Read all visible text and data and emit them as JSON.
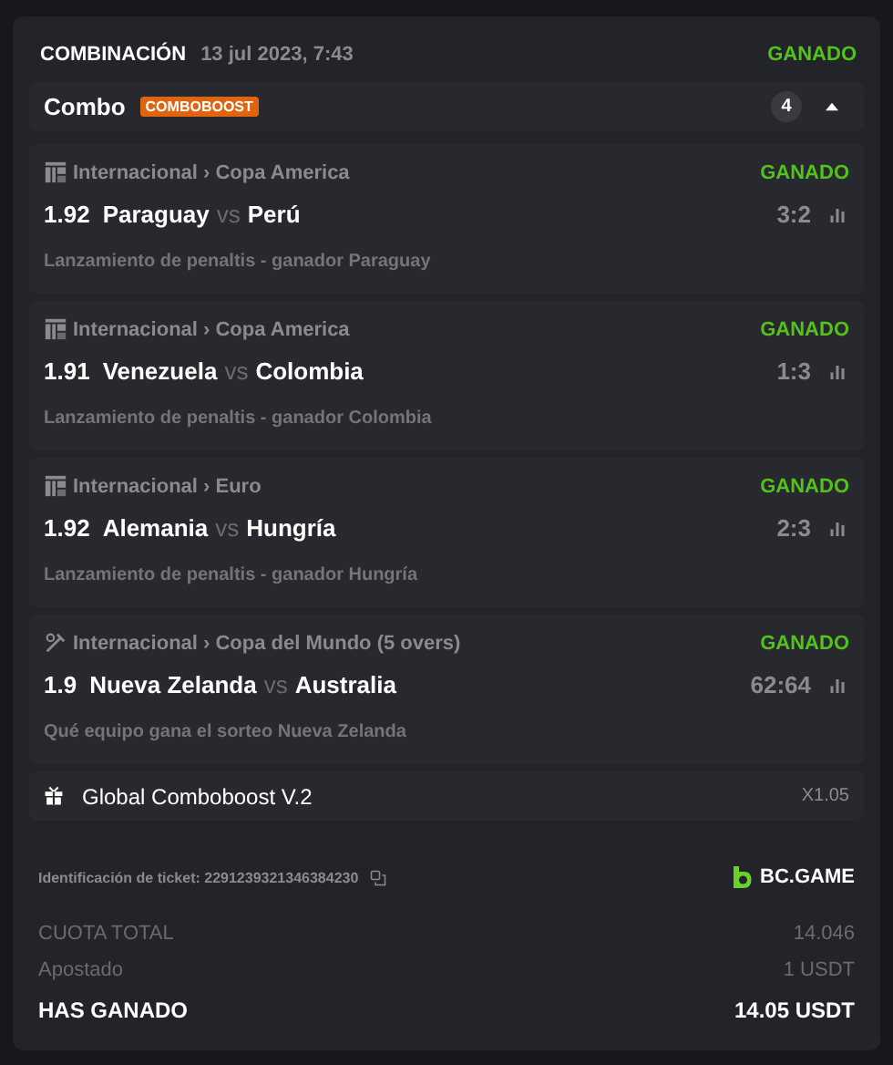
{
  "bet": {
    "type": "COMBINACIÓN",
    "date": "13 jul 2023, 7:43",
    "status": "GANADO",
    "won": true
  },
  "combo": {
    "title": "Combo",
    "badge": "COMBOBOOST",
    "count": "4",
    "expanded": true
  },
  "legs": [
    {
      "kind": "fifa",
      "path": "Internacional › Copa America",
      "status": "GANADO",
      "won": true,
      "odds": "1.92",
      "home": "Paraguay",
      "vs": "vs",
      "away": "Perú",
      "score": "3:2",
      "market": "Lanzamiento de penaltis - ganador Paraguay"
    },
    {
      "kind": "fifa",
      "path": "Internacional › Copa America",
      "status": "GANADO",
      "won": true,
      "odds": "1.91",
      "home": "Venezuela",
      "vs": "vs",
      "away": "Colombia",
      "score": "1:3",
      "market": "Lanzamiento de penaltis - ganador Colombia"
    },
    {
      "kind": "fifa",
      "path": "Internacional › Euro",
      "status": "GANADO",
      "won": true,
      "odds": "1.92",
      "home": "Alemania",
      "vs": "vs",
      "away": "Hungría",
      "score": "2:3",
      "market": "Lanzamiento de penaltis - ganador Hungría"
    },
    {
      "kind": "cricket",
      "path": "Internacional › Copa del Mundo (5 overs)",
      "status": "GANADO",
      "won": true,
      "odds": "1.9",
      "home": "Nueva Zelanda",
      "vs": "vs",
      "away": "Australia",
      "score": "62:64",
      "market": "Qué equipo gana el sorteo Nueva Zelanda"
    }
  ],
  "boost": {
    "label": "Global Comboboost V.2",
    "multiplier": "X1.05"
  },
  "ticket": {
    "label": "Identificación de ticket: 2291239321346384230",
    "brand": "BC.GAME"
  },
  "totals": [
    {
      "label": "CUOTA TOTAL",
      "value": "14.046",
      "emphasis": false
    },
    {
      "label": "Apostado",
      "value": "1 USDT",
      "emphasis": false
    },
    {
      "label": "HAS GANADO",
      "value": "14.05 USDT",
      "emphasis": true
    }
  ]
}
